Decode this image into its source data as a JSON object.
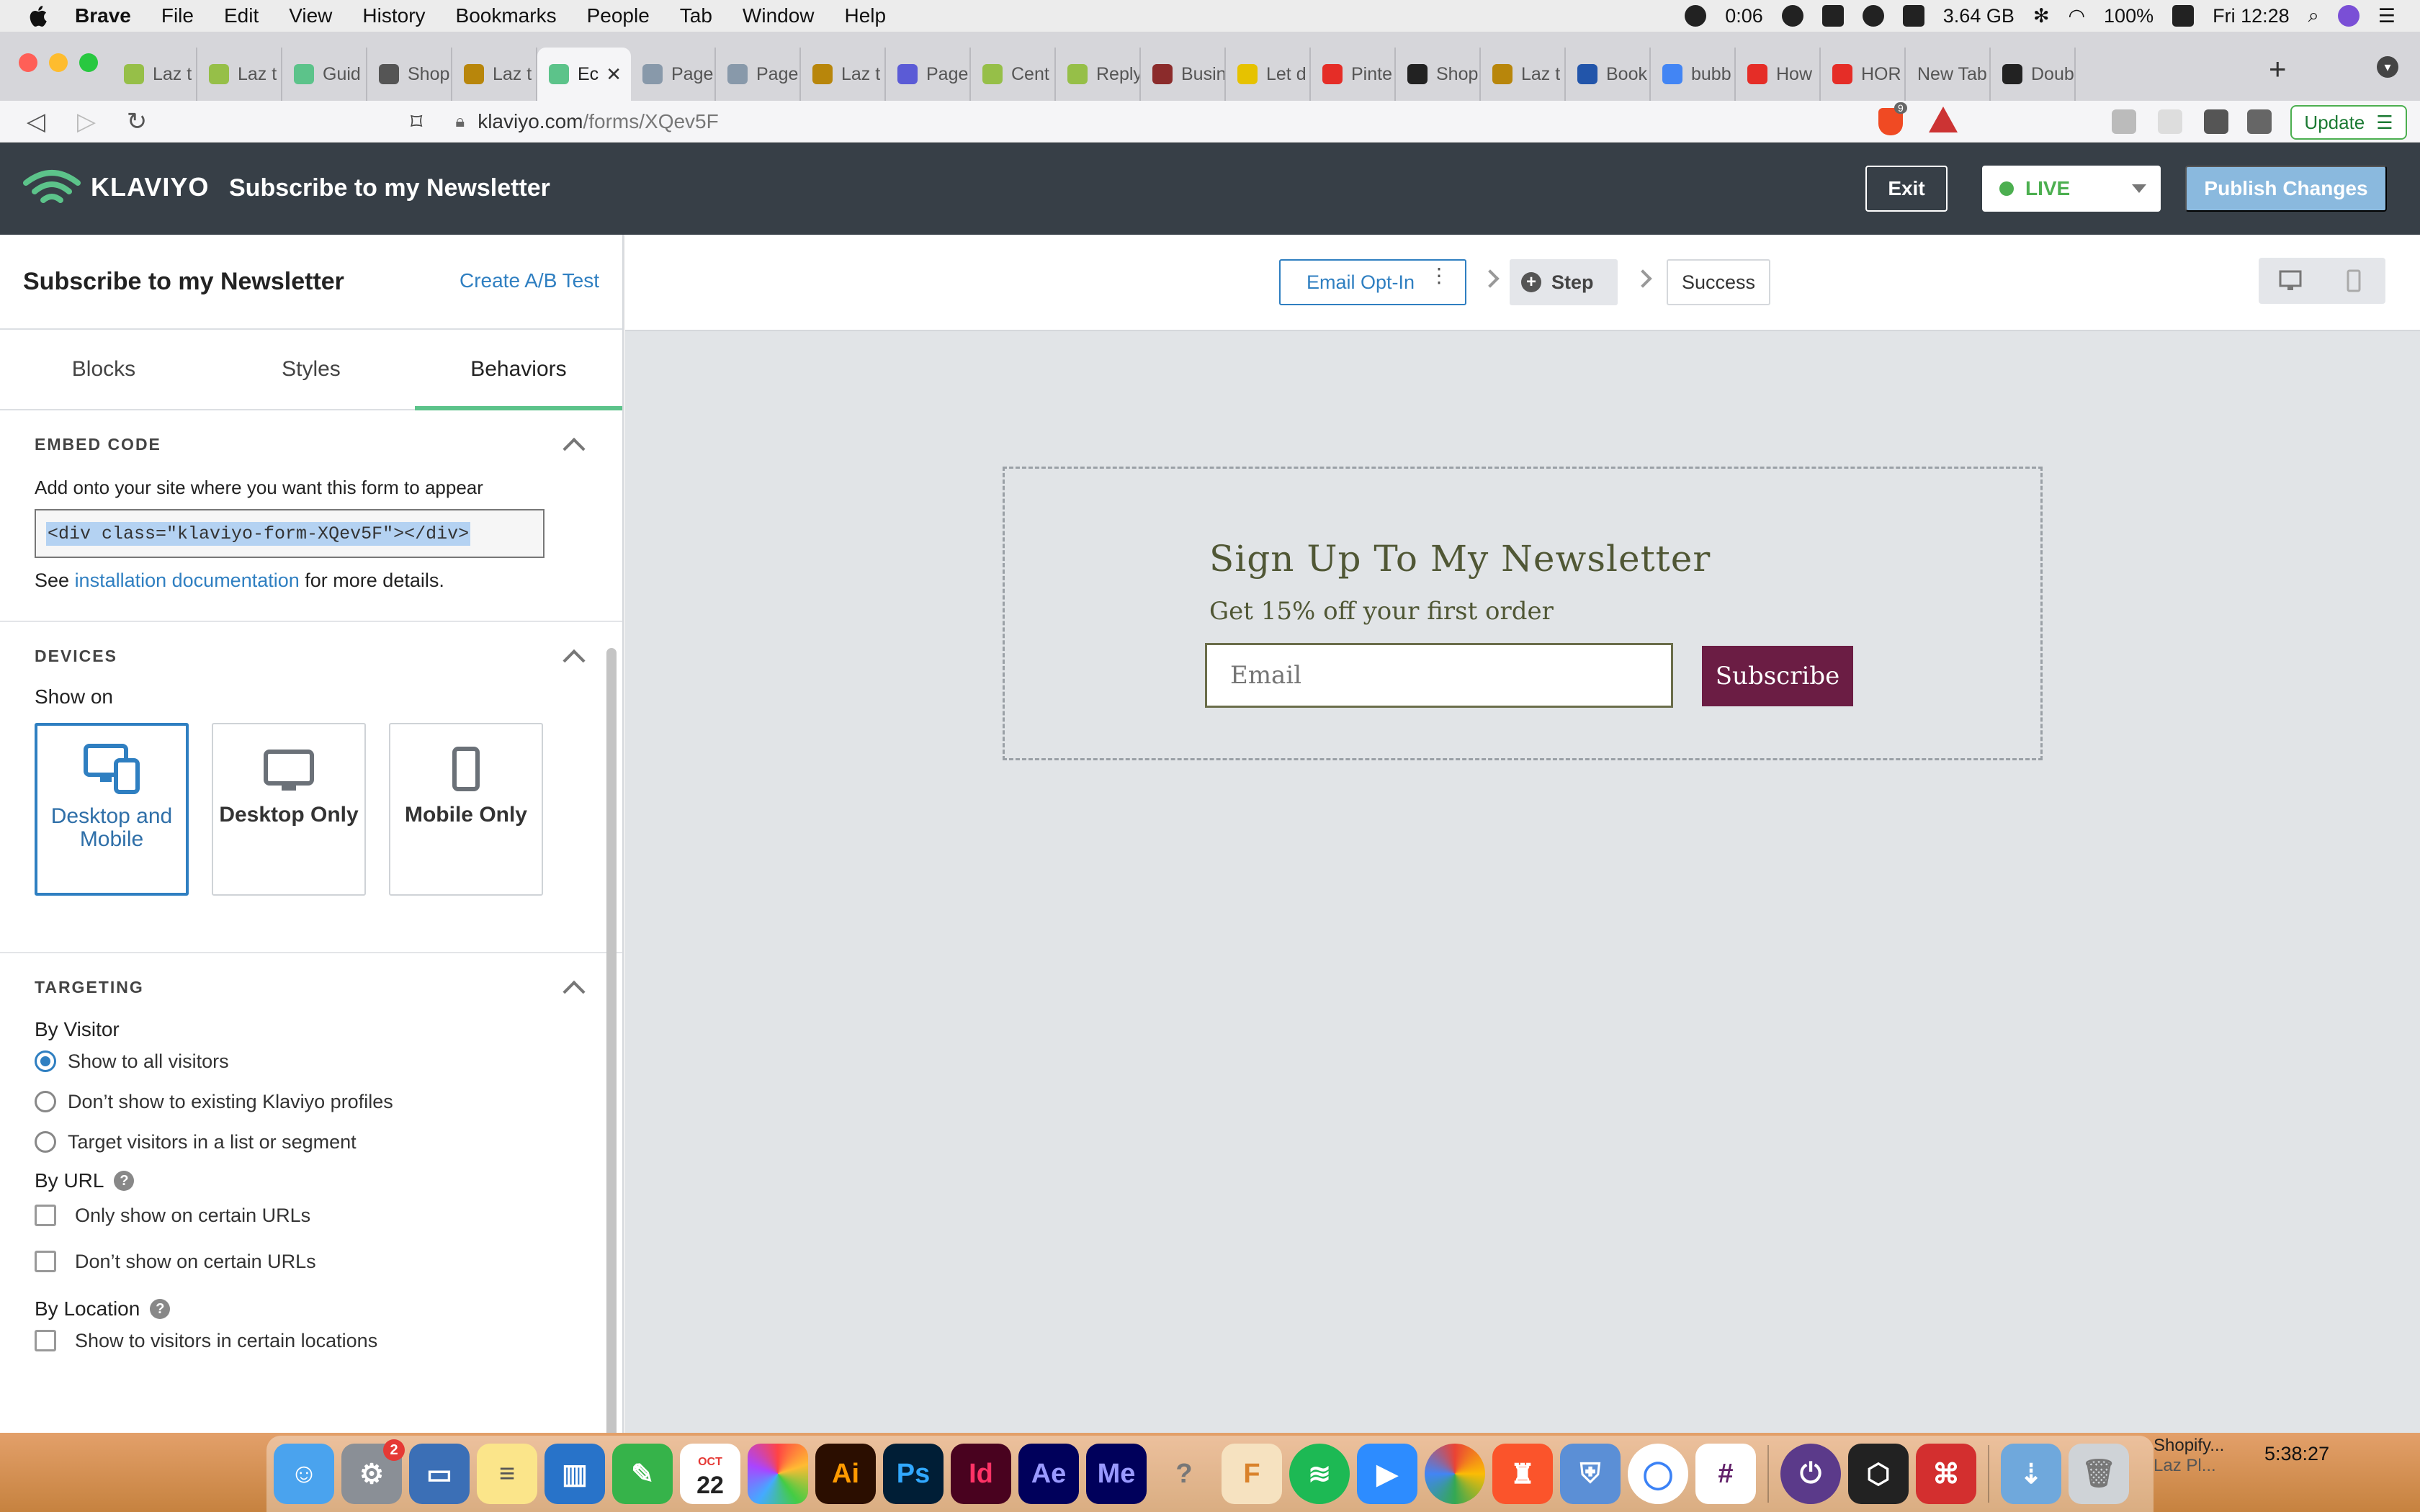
{
  "menubar": {
    "app": "Brave",
    "items": [
      "File",
      "Edit",
      "View",
      "History",
      "Bookmarks",
      "People",
      "Tab",
      "Window",
      "Help"
    ],
    "timer": "0:06",
    "memory": "3.64 GB",
    "battery": "100%",
    "clock": "Fri 12:28"
  },
  "browser": {
    "tabs": [
      {
        "label": "Laz t",
        "color": "#96bf48"
      },
      {
        "label": "Laz t",
        "color": "#96bf48"
      },
      {
        "label": "Guid",
        "color": "#5cc38a"
      },
      {
        "label": "Shop",
        "color": "#555555"
      },
      {
        "label": "Laz t",
        "color": "#b8860b"
      },
      {
        "label": "Ec",
        "color": "#5cc38a",
        "active": true
      },
      {
        "label": "Page",
        "color": "#8899aa"
      },
      {
        "label": "Page",
        "color": "#8899aa"
      },
      {
        "label": "Laz t",
        "color": "#b8860b"
      },
      {
        "label": "Page",
        "color": "#5b5bd6"
      },
      {
        "label": "Cent",
        "color": "#96bf48"
      },
      {
        "label": "Reply",
        "color": "#96bf48"
      },
      {
        "label": "Busin",
        "color": "#8b2b2b"
      },
      {
        "label": "Let d",
        "color": "#e6c200"
      },
      {
        "label": "Pinte",
        "color": "#e52d27"
      },
      {
        "label": "Shop",
        "color": "#222222"
      },
      {
        "label": "Laz t",
        "color": "#b8860b"
      },
      {
        "label": "Book",
        "color": "#2255aa"
      },
      {
        "label": "bubb",
        "color": "#4285f4"
      },
      {
        "label": "How",
        "color": "#e52d27"
      },
      {
        "label": "HOR",
        "color": "#e52d27"
      },
      {
        "label": "New Tab",
        "color": ""
      },
      {
        "label": "Doub",
        "color": "#222222"
      }
    ],
    "url_host": "klaviyo.com",
    "url_path": "/forms/XQev5F",
    "brave_badge": "9",
    "update_label": "Update"
  },
  "klaviyo_header": {
    "logo": "KLAVIYO",
    "title": "Subscribe to my Newsletter",
    "exit_label": "Exit",
    "status_label": "LIVE",
    "publish_label": "Publish Changes"
  },
  "left_panel": {
    "form_name": "Subscribe to my Newsletter",
    "ab_test_link": "Create A/B Test",
    "tabs": [
      "Blocks",
      "Styles",
      "Behaviors"
    ],
    "embed": {
      "title": "EMBED CODE",
      "instruction": "Add onto your site where you want this form to appear",
      "code": "<div class=\"klaviyo-form-XQev5F\"></div>",
      "see_prefix": "See",
      "doc_link": "installation documentation",
      "see_suffix": "for more details."
    },
    "devices": {
      "title": "DEVICES",
      "show_on": "Show on",
      "options": [
        {
          "label": "Desktop and Mobile",
          "selected": true
        },
        {
          "label": "Desktop Only",
          "selected": false
        },
        {
          "label": "Mobile Only",
          "selected": false
        }
      ]
    },
    "targeting": {
      "title": "TARGETING",
      "by_visitor": "By Visitor",
      "visitor_options": [
        {
          "label": "Show to all visitors",
          "selected": true
        },
        {
          "label": "Don’t show to existing Klaviyo profiles",
          "selected": false
        },
        {
          "label": "Target visitors in a list or segment",
          "selected": false
        }
      ],
      "by_url": "By URL",
      "url_options": [
        "Only show on certain URLs",
        "Don’t show on certain URLs"
      ],
      "by_location": "By Location",
      "location_options": [
        "Show to visitors in certain locations"
      ]
    }
  },
  "steps": {
    "email_optin": "Email Opt-In",
    "step": "Step",
    "success": "Success"
  },
  "form_preview": {
    "title": "Sign Up To My Newsletter",
    "subtitle": "Get 15% off your first order",
    "email_placeholder": "Email",
    "button_label": "Subscribe"
  },
  "dock": {
    "notes_label": "Shopify...",
    "notes_sub": "Laz Pl...",
    "clock": "5:38:27",
    "calendar_month": "OCT",
    "calendar_day": "22",
    "badge_count": "2"
  }
}
